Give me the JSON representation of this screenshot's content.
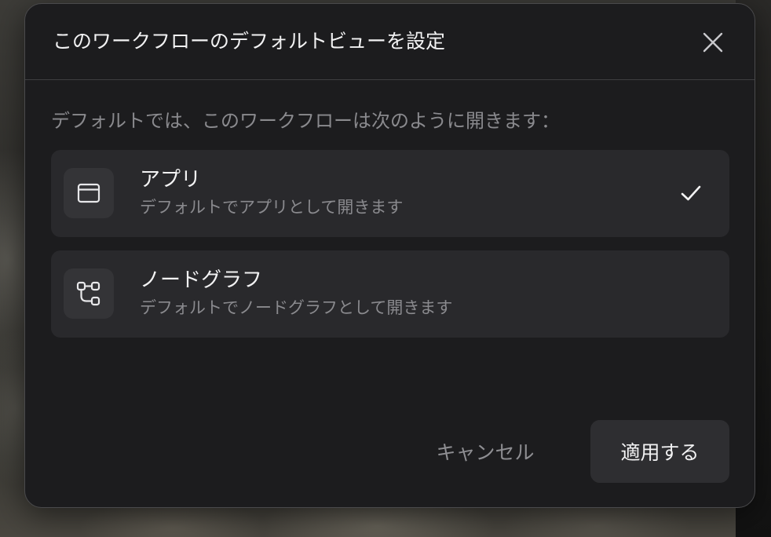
{
  "dialog": {
    "title": "このワークフローのデフォルトビューを設定",
    "close_icon": "close-icon",
    "subtitle": "デフォルトでは、このワークフローは次のように開きます：",
    "options": [
      {
        "label": "アプリ",
        "description": "デフォルトでアプリとして開きます",
        "icon": "app-window-icon",
        "selected": true
      },
      {
        "label": "ノードグラフ",
        "description": "デフォルトでノードグラフとして開きます",
        "icon": "node-graph-icon",
        "selected": false
      }
    ],
    "cancel_label": "キャンセル",
    "apply_label": "適用する"
  },
  "colors": {
    "dialog_bg": "#1c1c1e",
    "option_bg": "#29292c",
    "text_primary": "#f2f2f3",
    "text_secondary": "#8a8a8e"
  }
}
